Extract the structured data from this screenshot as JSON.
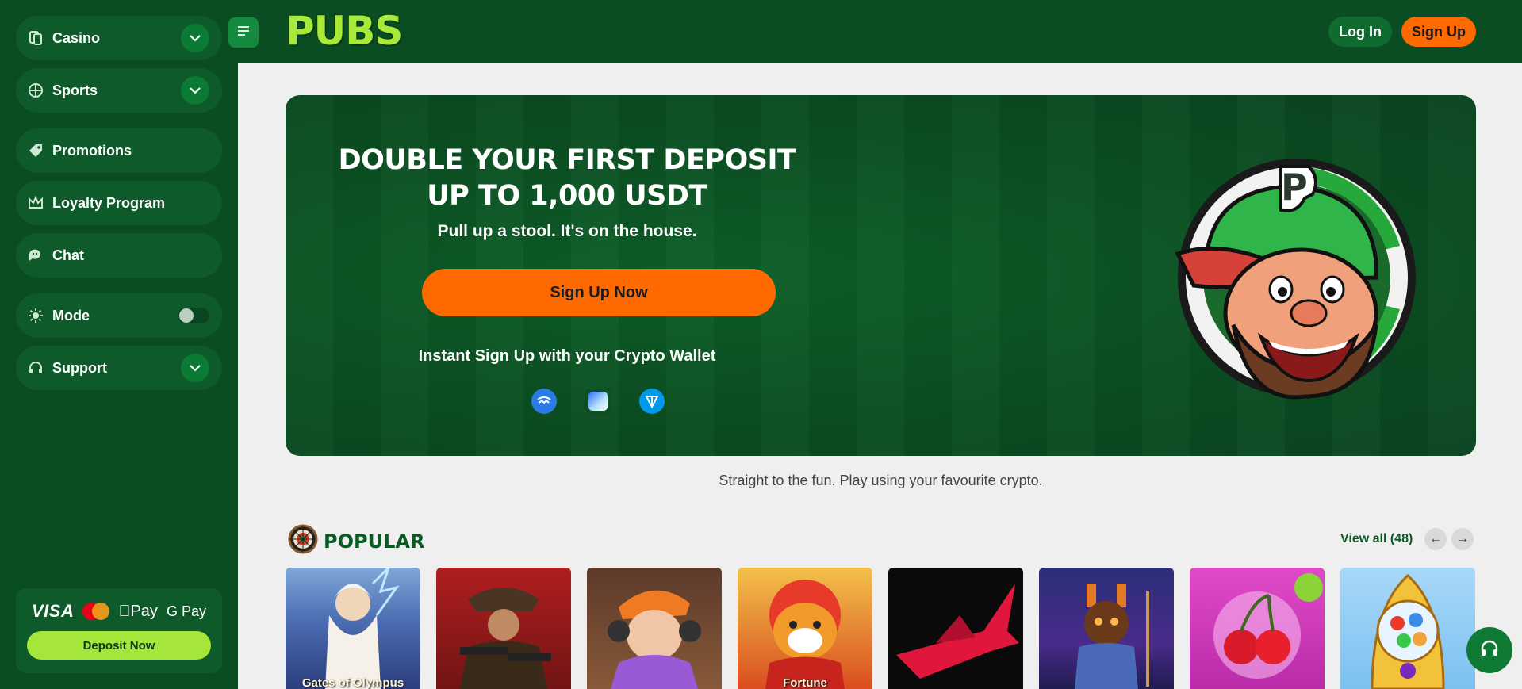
{
  "sidebar": {
    "items": [
      {
        "label": "Casino",
        "icon": "cards-icon",
        "expandable": true
      },
      {
        "label": "Sports",
        "icon": "ball-icon",
        "expandable": true
      },
      {
        "label": "Promotions",
        "icon": "tag-icon"
      },
      {
        "label": "Loyalty Program",
        "icon": "crown-icon"
      },
      {
        "label": "Chat",
        "icon": "chat-icon"
      },
      {
        "label": "Mode",
        "icon": "sun-icon",
        "toggle": false
      },
      {
        "label": "Support",
        "icon": "headset-icon",
        "expandable": true
      }
    ],
    "payments": {
      "visa": "VISA",
      "apple_pay": "Pay",
      "google_pay": "G Pay"
    },
    "deposit_label": "Deposit Now"
  },
  "header": {
    "logo": "PUBS",
    "login_label": "Log In",
    "signup_label": "Sign Up"
  },
  "hero": {
    "title": "DOUBLE YOUR FIRST DEPOSIT UP TO 1,000 USDT",
    "subtitle": "Pull up a stool. It's on the house.",
    "cta_label": "Sign Up Now",
    "wallet_text": "Instant Sign Up with your Crypto Wallet",
    "wallets": [
      "walletconnect-icon",
      "coinbase-wallet-icon",
      "ton-icon"
    ]
  },
  "tagline": "Straight to the fun. Play using your favourite crypto.",
  "popular": {
    "title": "POPULAR",
    "view_all": "View all (48)",
    "games": [
      {
        "name": "Gates of Olympus"
      },
      {
        "name": ""
      },
      {
        "name": ""
      },
      {
        "name": "Fortune"
      },
      {
        "name": ""
      },
      {
        "name": ""
      },
      {
        "name": ""
      },
      {
        "name": ""
      }
    ]
  },
  "colors": {
    "sidebar_bg": "#0b4d23",
    "accent_orange": "#ff6a00",
    "accent_lime": "#a6e63a",
    "page_bg": "#efefef"
  }
}
